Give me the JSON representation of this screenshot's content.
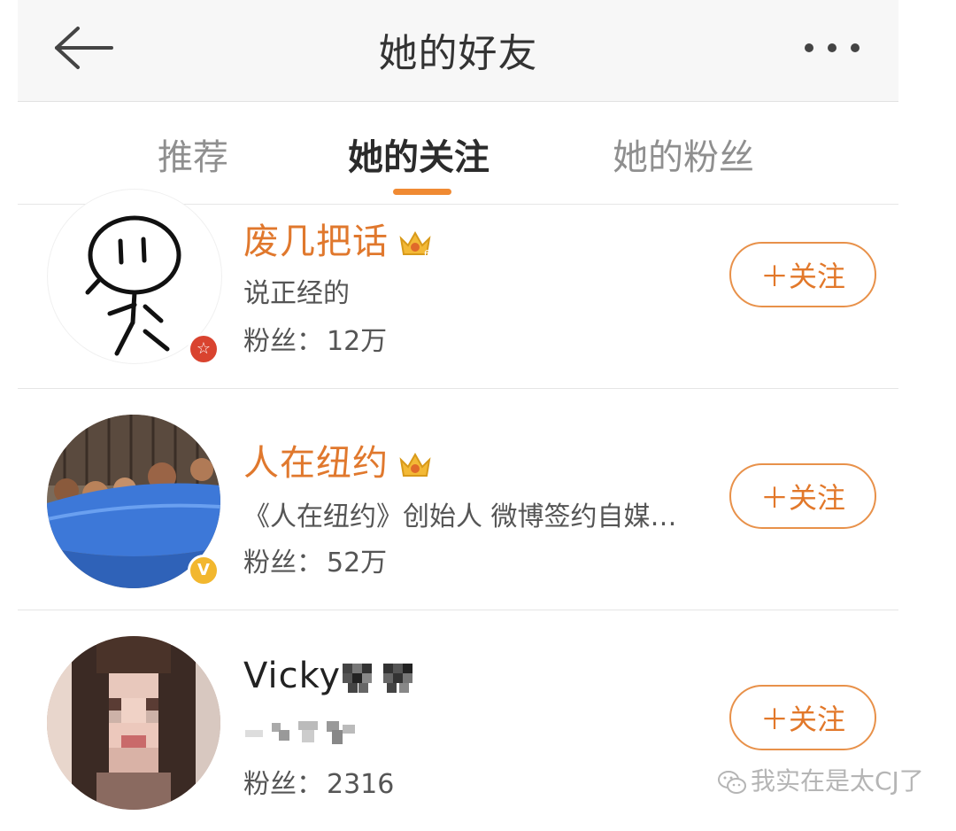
{
  "header": {
    "title": "她的好友",
    "back_icon": "arrow-left-icon",
    "more_icon": "more-dots-icon"
  },
  "tabs": [
    {
      "label": "推荐",
      "active": false
    },
    {
      "label": "她的关注",
      "active": true
    },
    {
      "label": "她的粉丝",
      "active": false
    }
  ],
  "accent_color": "#e0782d",
  "users": [
    {
      "name": "废几把话",
      "description": "说正经的",
      "fans_label": "粉丝：",
      "fans_count": "12万",
      "follow_label": "＋关注",
      "avatar_icon": "stick-figure-drawing",
      "badge_icon": "red-star-badge-icon",
      "crown_level": "6"
    },
    {
      "name": "人在纽约",
      "description": "《人在纽约》创始人 微博签约自媒…",
      "fans_label": "粉丝：",
      "fans_count": "52万",
      "follow_label": "＋关注",
      "avatar_icon": "children-in-pool-photo",
      "badge_icon": "verified-v-badge-icon",
      "badge_text": "V"
    },
    {
      "name": "Vicky",
      "description": "",
      "fans_label": "粉丝：",
      "fans_count": "2316",
      "follow_label": "＋关注",
      "avatar_icon": "pixelated-portrait"
    }
  ],
  "watermark": {
    "text": "我实在是太CJ了",
    "icon": "wechat-icon"
  }
}
